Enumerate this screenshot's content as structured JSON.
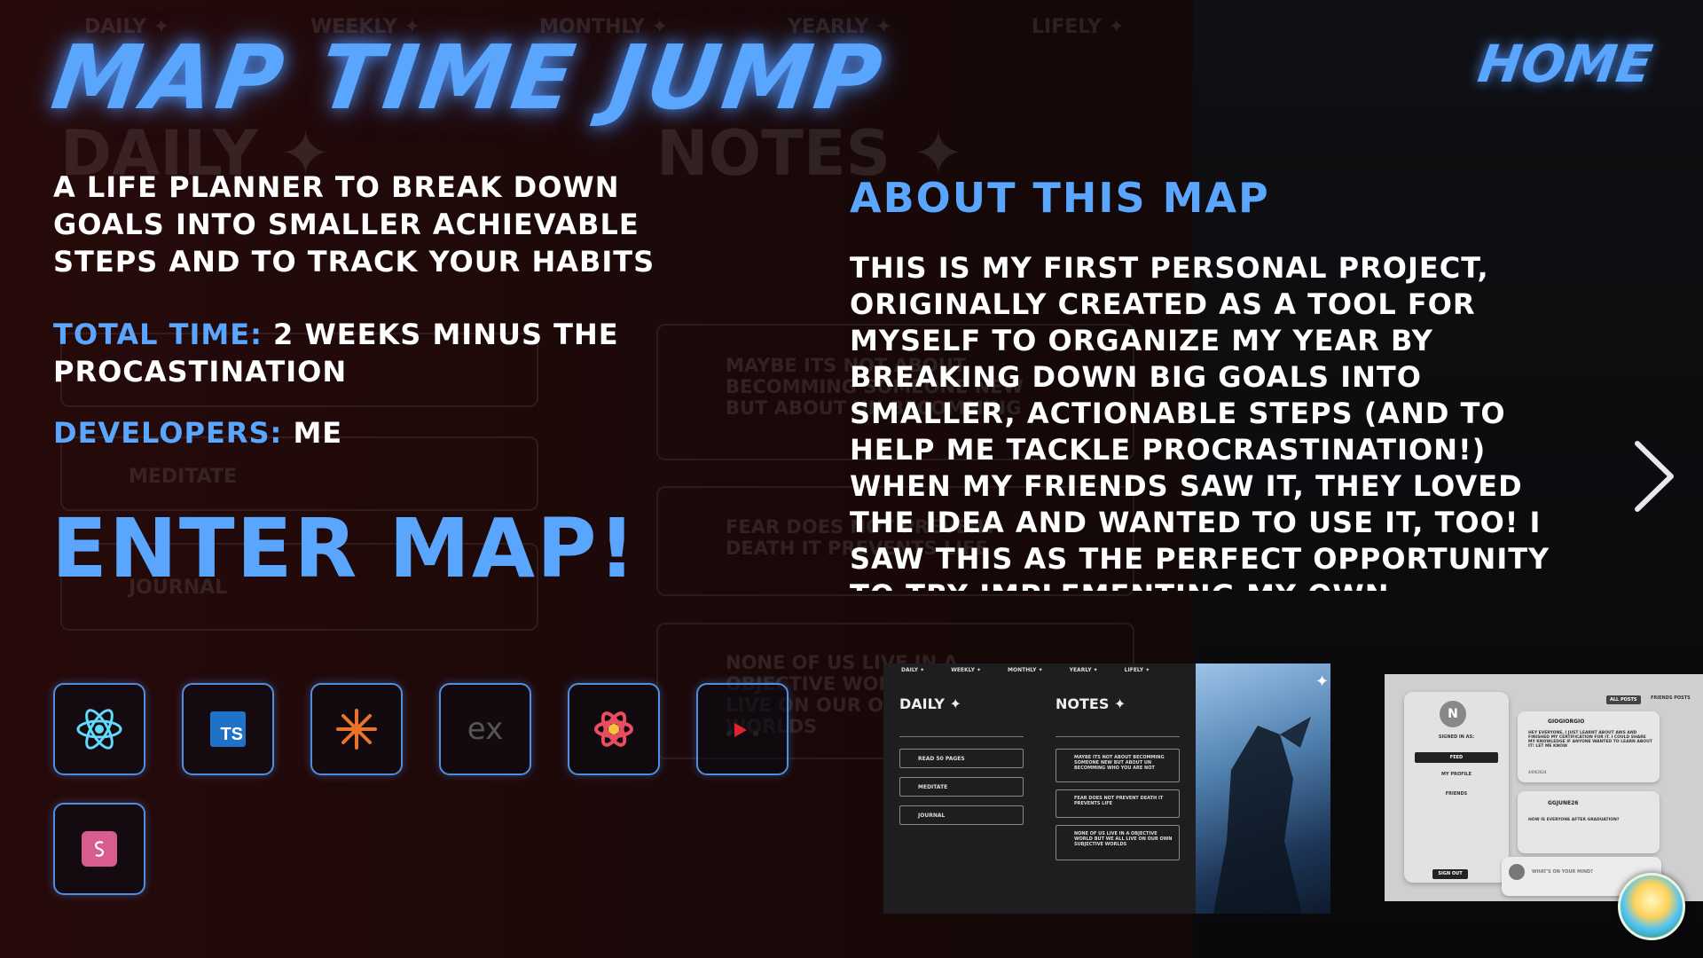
{
  "header": {
    "title": "MAP TIME JUMP",
    "home_label": "HOME"
  },
  "project": {
    "description": "A life planner to break down goals into smaller achievable steps and to track your habits",
    "total_time_label": "TOTAL TIME:",
    "total_time_value": "2 weeks minus the procastination",
    "developers_label": "DEVELOPERS:",
    "developers_value": "me",
    "enter_label": "ENTER MAP!"
  },
  "about": {
    "title": "ABOUT THIS MAP",
    "body": "This is my first personal project, originally created as a tool for myself to organize my year by breaking down big goals into smaller, actionable steps (and to help me tackle procrastination!) When my friends saw it, they loved the idea and wanted to use it, too! I saw this as the perfect opportunity to try implementing my own authentication system (something ive always been curious to do) and it"
  },
  "tech_icons": [
    "react-icon",
    "typescript-icon",
    "snowflake-icon",
    "express-icon",
    "framer-icon",
    "redux-icon",
    "styled-icon"
  ],
  "tech_ts_text": "TS",
  "tech_ex_text": "ex",
  "ghost": {
    "nav": [
      "DAILY ✦",
      "WEEKLY ✦",
      "MONTHLY ✦",
      "YEARLY ✦",
      "LIFELY ✦"
    ],
    "daily": "DAILY ✦",
    "notes": "NOTES ✦",
    "items": [
      "MEDITATE",
      "JOURNAL"
    ],
    "notes_items": [
      "MAYBE ITS NOT ABOUT BECOMMING SOMEONE NEW BUT ABOUT UN BECOMMING",
      "FEAR DOES NOT PREVENT DEATH IT PREVENTS LIFE",
      "NONE OF US LIVE IN A OBJECTIVE WORLD BUT WE ALL LIVE ON OUR OWN SUBJECTIVE WORLDS"
    ]
  },
  "screenshot1": {
    "nav": [
      "DAILY ✦",
      "WEEKLY ✦",
      "MONTHLY ✦",
      "YEARLY ✦",
      "LIFELY ✦"
    ],
    "daily": "DAILY ✦",
    "notes": "NOTES ✦",
    "tasks": [
      "READ 50 PAGES",
      "MEDITATE",
      "JOURNAL"
    ],
    "notes_items": [
      "MAYBE ITS NOT ABOUT BECOMMING SOMEONE NEW BUT ABOUT UN BECOMMING WHO YOU ARE NOT",
      "FEAR DOES NOT PREVENT DEATH IT PREVENTS LIFE",
      "NONE OF US LIVE IN A OBJECTIVE WORLD BUT WE ALL LIVE ON OUR OWN SUBJECTIVE WORLDS"
    ]
  },
  "screenshot2": {
    "avatar_letter": "N",
    "signed_in": "SIGNED IN AS:",
    "feed": "FEED",
    "my_profile": "MY PROFILE",
    "friends": "FRIENDS",
    "sign_out": "SIGN OUT",
    "all_posts": "ALL POSTS",
    "friends_posts": "FRIENDS POSTS",
    "post1_user": "GIOGIORGIO",
    "post1_text": "HEY EVERYONE, I JUST LEARNT ABOUT AWS AND FINISHED MY CERTIFICATION FOR IT. I COULD SHARE MY KNOWLEDGE IF ANYONE WANTED TO LEARN ABOUT IT! LET ME KNOW",
    "post2_user": "GGJUNE26",
    "post2_text": "HOW IS EVERYONE AFTER GRADUATION?",
    "composer_placeholder": "WHAT'S ON YOUR MIND?",
    "date": "4/09/2024"
  },
  "colors": {
    "accent": "#5aa6ff",
    "text": "#ffffff",
    "bg": "#140909"
  }
}
